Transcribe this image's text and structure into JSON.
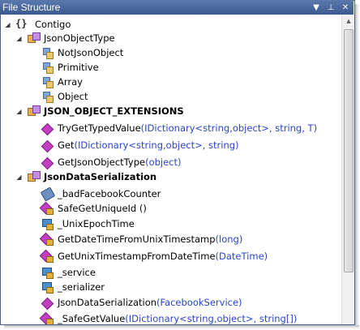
{
  "window": {
    "title": "File Structure",
    "buttons": {
      "menu_icon": "dropdown-icon",
      "pin_icon": "pin-icon",
      "close_icon": "close-icon"
    }
  },
  "tree": [
    {
      "label": "Contigo",
      "bold": false,
      "icon": "namespace-icon",
      "expander": "expanded",
      "indent": 0
    },
    {
      "label": "JsonObjectType",
      "bold": false,
      "icon": "enum-icon",
      "expander": "expanded",
      "indent": 1
    },
    {
      "label": "NotJsonObject",
      "icon": "enum-member-icon",
      "indent": 2
    },
    {
      "label": "Primitive",
      "icon": "enum-member-icon",
      "indent": 2
    },
    {
      "label": "Array",
      "icon": "enum-member-icon",
      "indent": 2
    },
    {
      "label": "Object",
      "icon": "enum-member-icon",
      "indent": 2
    },
    {
      "label": "JSON_OBJECT_EXTENSIONS",
      "bold": true,
      "icon": "static-class-icon",
      "expander": "expanded",
      "indent": 1
    },
    {
      "label": "TryGetTypedValue",
      "sig": "(IDictionary<string,object>, string, T)",
      "icon": "method-icon",
      "indent": 2
    },
    {
      "label": "Get",
      "sig": "(IDictionary<string,object>, string)",
      "icon": "method-icon",
      "indent": 2
    },
    {
      "label": "GetJsonObjectType",
      "sig": "(object)",
      "icon": "method-icon",
      "indent": 2
    },
    {
      "label": "JsonDataSerialization",
      "bold": true,
      "icon": "class-icon",
      "expander": "expanded",
      "indent": 1
    },
    {
      "label": "_badFacebookCounter",
      "icon": "static-field-icon",
      "indent": 2
    },
    {
      "label": "SafeGetUniqueId ()",
      "icon": "private-method-icon",
      "indent": 2
    },
    {
      "label": "_UnixEpochTime",
      "icon": "private-field-icon",
      "indent": 2
    },
    {
      "label": "GetDateTimeFromUnixTimestamp",
      "sig": "(long)",
      "icon": "private-method-icon",
      "indent": 2
    },
    {
      "label": "GetUnixTimestampFromDateTime",
      "sig": "(DateTime)",
      "icon": "private-method-icon",
      "indent": 2
    },
    {
      "label": "_service",
      "icon": "private-field-icon",
      "indent": 2
    },
    {
      "label": "_serializer",
      "icon": "private-field-icon",
      "indent": 2
    },
    {
      "label": "JsonDataSerialization",
      "sig": "(FacebookService)",
      "icon": "constructor-icon",
      "indent": 2
    },
    {
      "label": "_SafeGetValue",
      "sig": "(IDictionary<string,object>, string[])",
      "icon": "private-method-icon",
      "indent": 2
    }
  ],
  "colors": {
    "titlebar": "#3c5a8f",
    "signature": "#2b45c8"
  }
}
